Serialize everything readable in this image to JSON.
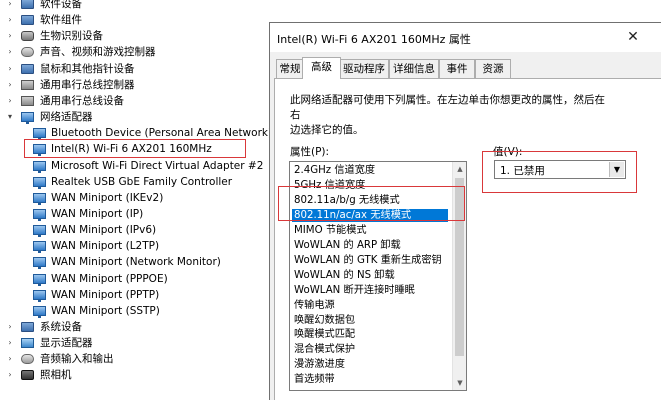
{
  "device_manager": {
    "categories_top": [
      {
        "label": "软件设备",
        "icon": "software-device-icon"
      },
      {
        "label": "软件组件",
        "icon": "software-component-icon"
      },
      {
        "label": "生物识别设备",
        "icon": "biometric-device-icon"
      },
      {
        "label": "声音、视频和游戏控制器",
        "icon": "sound-icon"
      },
      {
        "label": "鼠标和其他指针设备",
        "icon": "mouse-icon"
      },
      {
        "label": "通用串行总线控制器",
        "icon": "usb-controller-icon"
      },
      {
        "label": "通用串行总线设备",
        "icon": "usb-device-icon"
      },
      {
        "label": "网络适配器",
        "icon": "network-adapter-icon"
      }
    ],
    "network_adapters": [
      "Bluetooth Device (Personal Area Network)",
      "Intel(R) Wi-Fi 6 AX201 160MHz",
      "Microsoft Wi-Fi Direct Virtual Adapter #2",
      "Realtek USB GbE Family Controller",
      "WAN Miniport (IKEv2)",
      "WAN Miniport (IP)",
      "WAN Miniport (IPv6)",
      "WAN Miniport (L2TP)",
      "WAN Miniport (Network Monitor)",
      "WAN Miniport (PPPOE)",
      "WAN Miniport (PPTP)",
      "WAN Miniport (SSTP)"
    ],
    "categories_bottom": [
      {
        "label": "系统设备",
        "icon": "system-device-icon"
      },
      {
        "label": "显示适配器",
        "icon": "display-adapter-icon"
      },
      {
        "label": "音频输入和输出",
        "icon": "audio-io-icon"
      },
      {
        "label": "照相机",
        "icon": "camera-icon"
      }
    ]
  },
  "dialog": {
    "title": "Intel(R) Wi-Fi 6 AX201 160MHz 属性",
    "close_glyph": "✕",
    "tabs": [
      "常规",
      "高级",
      "驱动程序",
      "详细信息",
      "事件",
      "资源"
    ],
    "active_tab": "高级",
    "description_line1": "此网络适配器可使用下列属性。在左边单击你想更改的属性，然后在右",
    "description_line2": "边选择它的值。",
    "properties_label": "属性(P):",
    "value_label": "值(V):",
    "properties": [
      "2.4GHz 信道宽度",
      "5GHz 信道宽度",
      "802.11a/b/g 无线模式",
      "802.11n/ac/ax 无线模式",
      "MIMO 节能模式",
      "WoWLAN 的 ARP 卸载",
      "WoWLAN 的 GTK 重新生成密钥",
      "WoWLAN 的 NS 卸载",
      "WoWLAN 断开连接时睡眠",
      "传输电源",
      "唤醒幻数据包",
      "唤醒模式匹配",
      "混合模式保护",
      "漫游激进度",
      "首选频带"
    ],
    "selected_property": "802.11n/ac/ax 无线模式",
    "value": "1. 已禁用",
    "scroll_up_glyph": "▲",
    "scroll_down_glyph": "▼",
    "dropdown_glyph": "▼"
  },
  "colors": {
    "selection": "#0078d7",
    "highlight_box": "#d9383a",
    "dialog_bg": "#f0f0f0"
  }
}
